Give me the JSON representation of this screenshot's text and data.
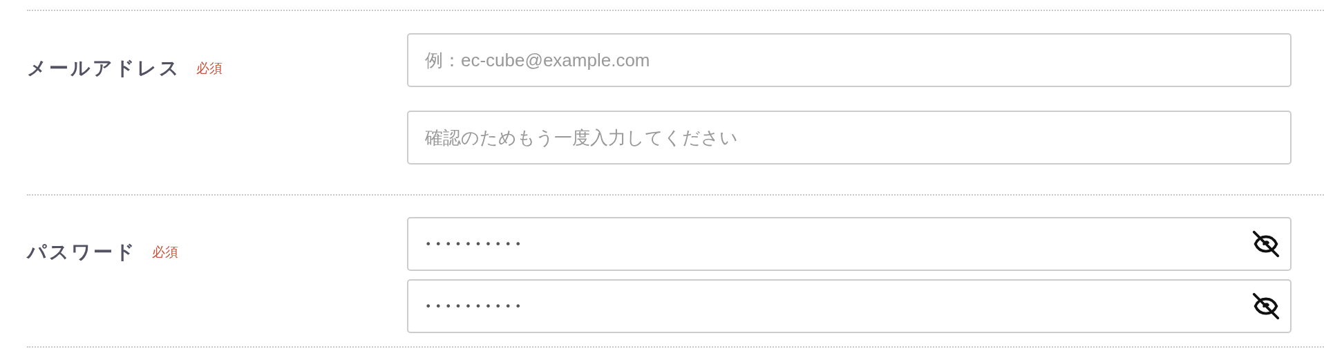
{
  "rows": [
    {
      "label": "メールアドレス",
      "required_badge": "必須",
      "fields": [
        {
          "kind": "text",
          "placeholder": "例：ec-cube@example.com"
        },
        {
          "kind": "text",
          "placeholder": "確認のためもう一度入力してください"
        }
      ]
    },
    {
      "label": "パスワード",
      "required_badge": "必須",
      "fields": [
        {
          "kind": "password",
          "value": "••••••••••",
          "masked": true
        },
        {
          "kind": "password",
          "value": "••••••••••",
          "masked": true
        }
      ]
    }
  ]
}
